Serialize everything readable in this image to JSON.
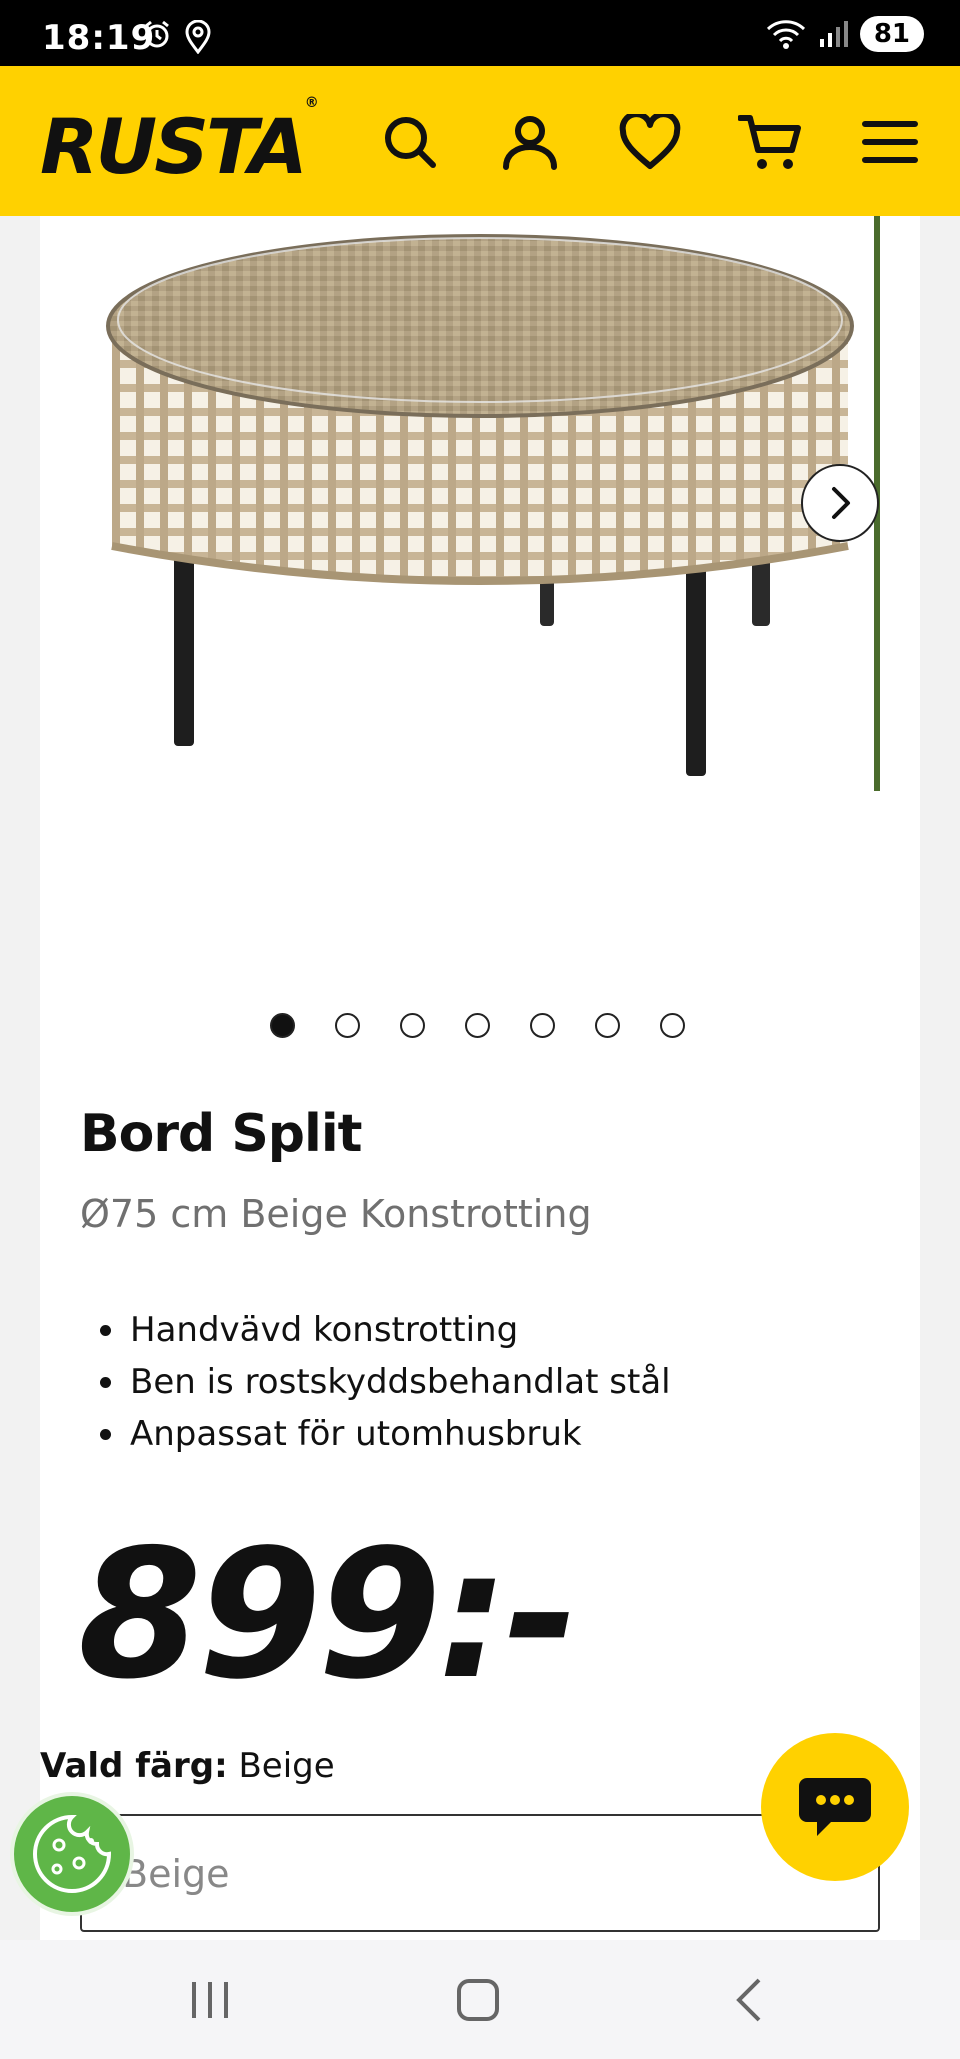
{
  "status_bar": {
    "time": "18:19",
    "battery": "81",
    "icons": [
      "alarm-icon",
      "location-icon",
      "wifi-icon",
      "signal-icon"
    ]
  },
  "header": {
    "logo_text": "RUSTA",
    "logo_mark": "®",
    "background_color": "#ffd100",
    "icons": [
      "search-icon",
      "account-icon",
      "wishlist-heart-icon",
      "cart-icon",
      "menu-icon"
    ]
  },
  "gallery": {
    "image_count": 7,
    "active_index": 0,
    "next_icon": "chevron-right-icon"
  },
  "product": {
    "title": "Bord Split",
    "subtitle": "Ø75 cm Beige Konstrotting",
    "features": [
      "Handvävd konstrotting",
      "Ben is rostskyddsbehandlat stål",
      "Anpassat för utomhusbruk"
    ],
    "price": "899:-"
  },
  "color_picker": {
    "label": "Vald färg:",
    "selected": "Beige",
    "select_value": "Beige"
  },
  "floating": {
    "chat_icon": "chat-bubble-icon",
    "cookie_icon": "cookie-icon"
  },
  "nav_bar": {
    "icons": [
      "recent-apps-icon",
      "home-icon",
      "back-icon"
    ]
  }
}
